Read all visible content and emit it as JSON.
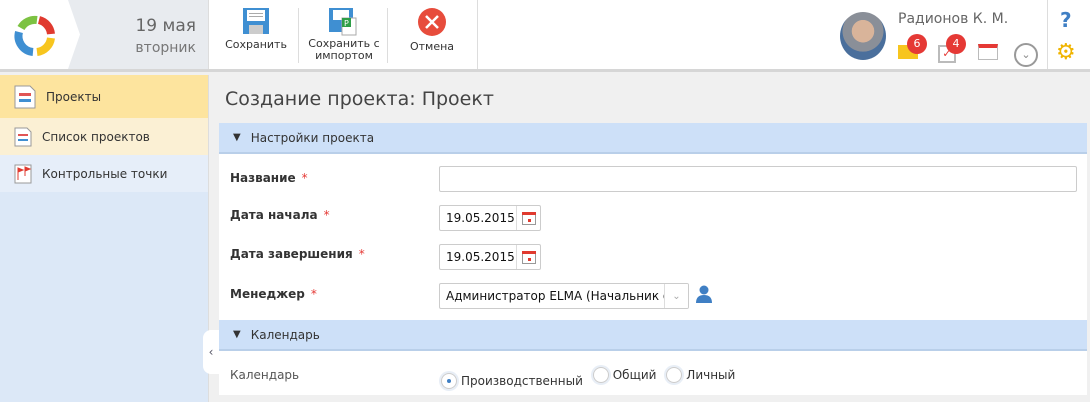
{
  "header": {
    "date": "19 мая",
    "weekday": "вторник",
    "user_name": "Радионов К. М.",
    "mail_count": "6",
    "tasks_count": "4",
    "help": "?"
  },
  "toolbar": {
    "save": "Сохранить",
    "save_import_1": "Сохранить с",
    "save_import_2": "импортом",
    "cancel": "Отмена"
  },
  "sidebar": {
    "items": [
      {
        "label": "Проекты"
      },
      {
        "label": "Список проектов"
      },
      {
        "label": "Контрольные точки"
      }
    ]
  },
  "page": {
    "title": "Создание проекта: Проект"
  },
  "sections": {
    "settings": "Настройки проекта",
    "calendar": "Календарь"
  },
  "form": {
    "name_label": "Название",
    "name_value": "",
    "required_mark": "*",
    "start_label": "Дата начала",
    "start_value": "19.05.2015",
    "end_label": "Дата завершения",
    "end_value": "19.05.2015",
    "manager_label": "Менеджер",
    "manager_value": "Администратор ELMA (Начальник отде",
    "calendar_label": "Календарь",
    "calendar_options": [
      "Производственный",
      "Общий",
      "Личный"
    ],
    "calendar_selected": "Производственный"
  }
}
